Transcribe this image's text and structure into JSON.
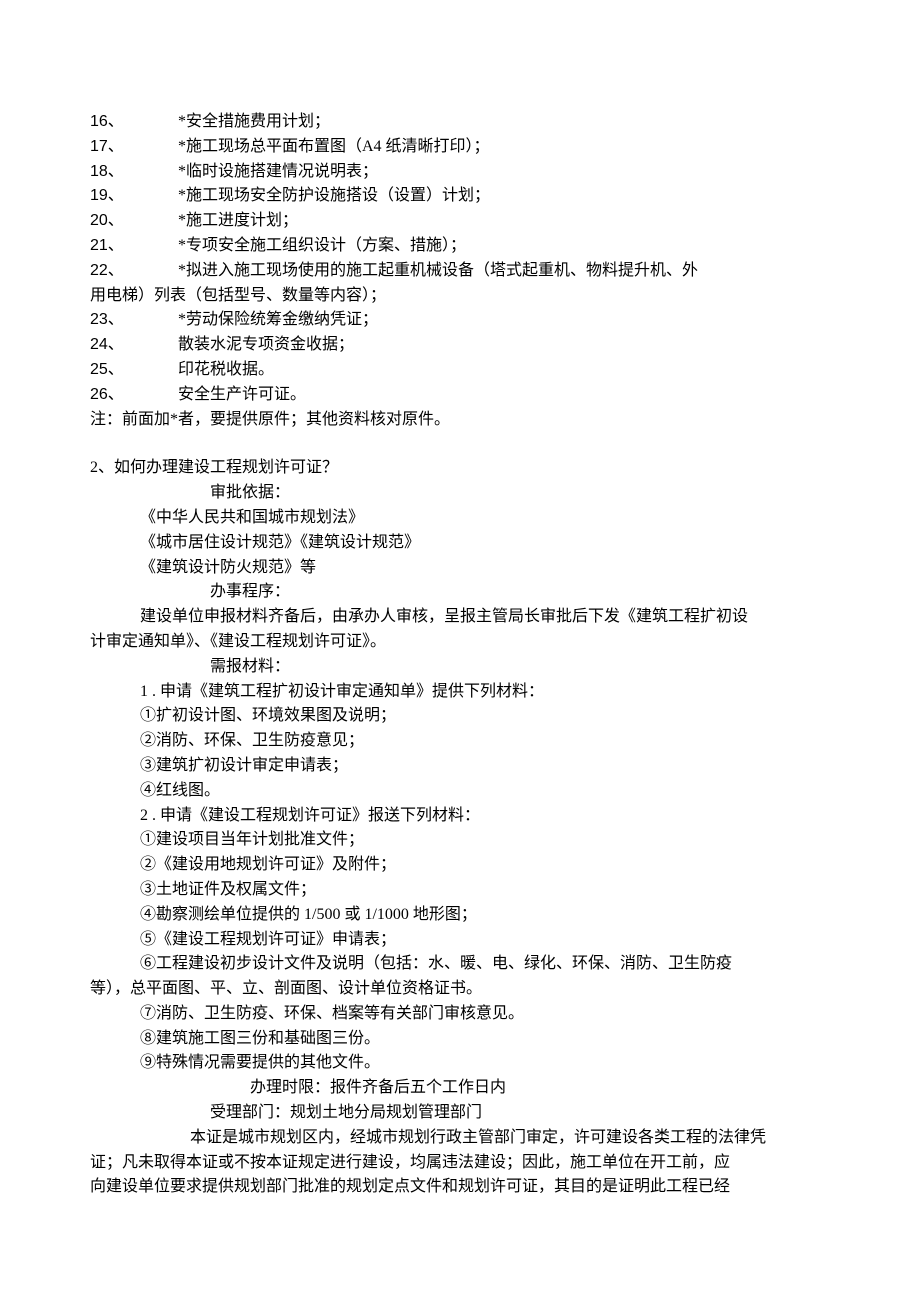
{
  "list": {
    "items": [
      {
        "num": "16、",
        "text": "*安全措施费用计划；"
      },
      {
        "num": "17、",
        "text": "*施工现场总平面布置图（A4 纸清晰打印）；"
      },
      {
        "num": "18、",
        "text": "*临时设施搭建情况说明表；"
      },
      {
        "num": "19、",
        "text": "*施工现场安全防护设施搭设（设置）计划；"
      },
      {
        "num": "20、",
        "text": "*施工进度计划；"
      },
      {
        "num": "21、",
        "text": "*专项安全施工组织设计（方案、措施）；"
      },
      {
        "num": "22、",
        "text": "*拟进入施工现场使用的施工起重机械设备（塔式起重机、物料提升机、外"
      }
    ],
    "cont22": "用电梯）列表（包括型号、数量等内容）；",
    "items2": [
      {
        "num": "23、",
        "text": "*劳动保险统筹金缴纳凭证；"
      },
      {
        "num": "24、",
        "text": "散装水泥专项资金收据；"
      },
      {
        "num": "25、",
        "text": "印花税收据。"
      },
      {
        "num": "26、",
        "text": "安全生产许可证。"
      }
    ],
    "note": "注：前面加*者，要提供原件；其他资料核对原件。"
  },
  "section2": {
    "q": "2、如何办理建设工程规划许可证？",
    "basis_label": "审批依据：",
    "basis": [
      "《中华人民共和国城市规划法》",
      "《城市居住设计规范》《建筑设计规范》",
      "《建筑设计防火规范》等"
    ],
    "proc_label": "办事程序：",
    "proc_line1": "建设单位申报材料齐备后，由承办人审核，呈报主管局长审批后下发《建筑工程扩初设",
    "proc_line2": "计审定通知单》、《建设工程规划许可证》。",
    "materials_label": "需报材料：",
    "m1_head": "1 . 申请《建筑工程扩初设计审定通知单》提供下列材料：",
    "m1_items": [
      "①扩初设计图、环境效果图及说明；",
      "②消防、环保、卫生防疫意见；",
      "③建筑扩初设计审定申请表；",
      "④红线图。"
    ],
    "m2_head": "2 . 申请《建设工程规划许可证》报送下列材料：",
    "m2_items": [
      "①建设项目当年计划批准文件；",
      "②《建设用地规划许可证》及附件；",
      "③土地证件及权属文件；",
      "④勘察测绘单位提供的 1/500 或 1/1000 地形图；",
      "⑤《建设工程规划许可证》申请表；"
    ],
    "m2_6a": "⑥工程建设初步设计文件及说明（包括：水、暖、电、绿化、环保、消防、卫生防疫",
    "m2_6b": "等），总平面图、平、立、剖面图、设计单位资格证书。",
    "m2_items_tail": [
      "⑦消防、卫生防疫、环保、档案等有关部门审核意见。",
      "⑧建筑施工图三份和基础图三份。",
      "⑨特殊情况需要提供的其他文件。"
    ],
    "timelimit": "办理时限：报件齐备后五个工作日内",
    "dept": "受理部门：规划土地分局规划管理部门",
    "tail1": "本证是城市规划区内，经城市规划行政主管部门审定，许可建设各类工程的法律凭",
    "tail2": "证；凡未取得本证或不按本证规定进行建设，均属违法建设；因此，施工单位在开工前，应",
    "tail3": "向建设单位要求提供规划部门批准的规划定点文件和规划许可证，其目的是证明此工程已经"
  }
}
